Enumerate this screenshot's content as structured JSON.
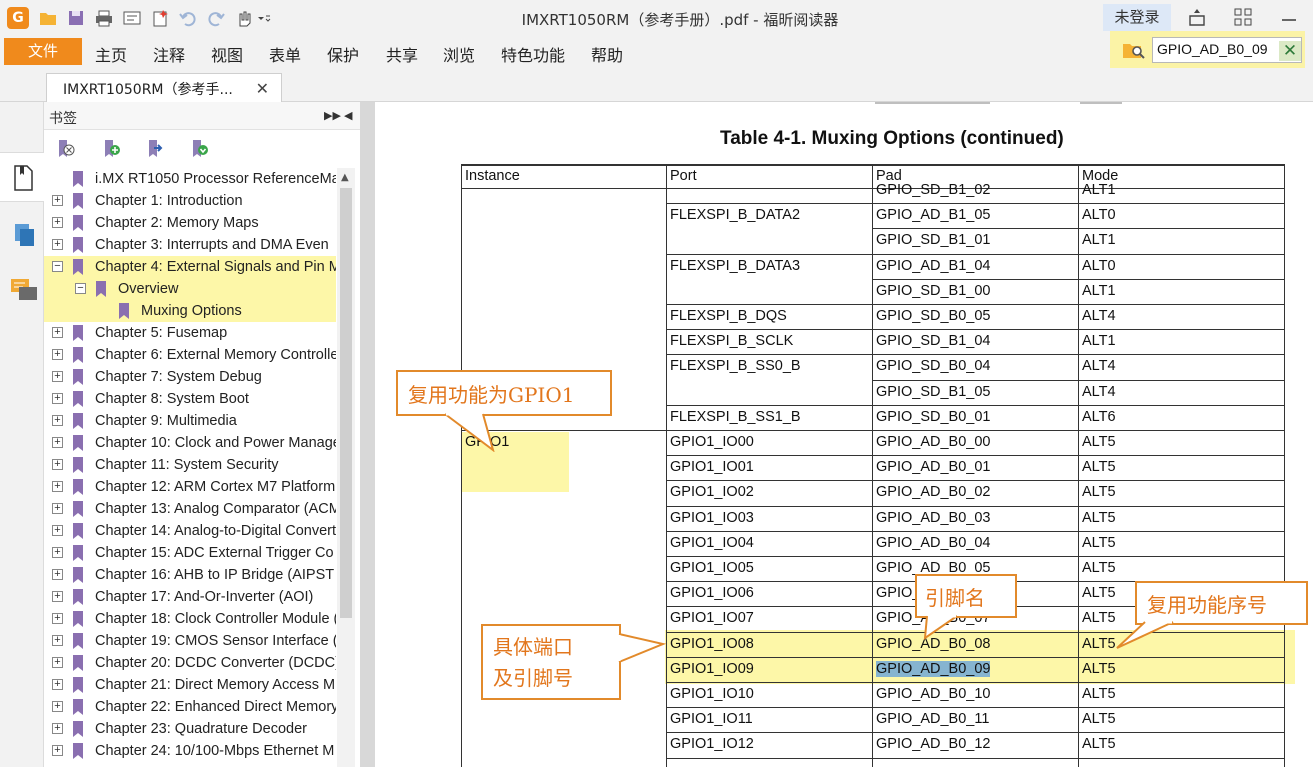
{
  "window": {
    "title": "IMXRT1050RM（参考手册）.pdf - 福昕阅读器",
    "app_icon": "G",
    "login_label": "未登录",
    "accent": "#f08a1c"
  },
  "menu": {
    "file_label": "文件",
    "items": [
      "主页",
      "注释",
      "视图",
      "表单",
      "保护",
      "共享",
      "浏览",
      "特色功能",
      "帮助"
    ]
  },
  "search": {
    "value": "GPIO_AD_B0_09"
  },
  "tab": {
    "label": "IMXRT1050RM（参考手..."
  },
  "bookmarks": {
    "panel_title": "书签",
    "items": [
      {
        "label": "i.MX RT1050 Processor ReferenceMa",
        "level": 0,
        "expander": ""
      },
      {
        "label": "Chapter 1: Introduction",
        "level": 0,
        "expander": "+"
      },
      {
        "label": "Chapter 2: Memory Maps",
        "level": 0,
        "expander": "+"
      },
      {
        "label": "Chapter 3: Interrupts and DMA Even",
        "level": 0,
        "expander": "+"
      },
      {
        "label": "Chapter 4: External Signals and Pin M",
        "level": 0,
        "expander": "-"
      },
      {
        "label": "Overview",
        "level": 1,
        "expander": "-"
      },
      {
        "label": "Muxing Options",
        "level": 2,
        "expander": ""
      },
      {
        "label": "Chapter 5:  Fusemap",
        "level": 0,
        "expander": "+"
      },
      {
        "label": "Chapter 6: External Memory Controlle",
        "level": 0,
        "expander": "+"
      },
      {
        "label": "Chapter 7: System Debug",
        "level": 0,
        "expander": "+"
      },
      {
        "label": "Chapter 8: System Boot",
        "level": 0,
        "expander": "+"
      },
      {
        "label": "Chapter 9: Multimedia",
        "level": 0,
        "expander": "+"
      },
      {
        "label": "Chapter 10: Clock and Power Manage",
        "level": 0,
        "expander": "+"
      },
      {
        "label": "Chapter 11: System Security",
        "level": 0,
        "expander": "+"
      },
      {
        "label": "Chapter 12: ARM Cortex M7 Platform",
        "level": 0,
        "expander": "+"
      },
      {
        "label": "Chapter 13: Analog Comparator (ACM",
        "level": 0,
        "expander": "+"
      },
      {
        "label": "Chapter 14: Analog-to-Digital Convert",
        "level": 0,
        "expander": "+"
      },
      {
        "label": "Chapter 15: ADC External Trigger Co",
        "level": 0,
        "expander": "+"
      },
      {
        "label": "Chapter 16: AHB to IP Bridge (AIPST",
        "level": 0,
        "expander": "+"
      },
      {
        "label": "Chapter 17: And-Or-Inverter (AOI)",
        "level": 0,
        "expander": "+"
      },
      {
        "label": "Chapter 18: Clock Controller Module (",
        "level": 0,
        "expander": "+"
      },
      {
        "label": "Chapter 19: CMOS Sensor Interface (",
        "level": 0,
        "expander": "+"
      },
      {
        "label": "Chapter 20: DCDC Converter (DCDC)",
        "level": 0,
        "expander": "+"
      },
      {
        "label": "Chapter 21: Direct Memory Access M",
        "level": 0,
        "expander": "+"
      },
      {
        "label": "Chapter 22: Enhanced Direct Memory",
        "level": 0,
        "expander": "+"
      },
      {
        "label": "Chapter 23: Quadrature Decoder",
        "level": 0,
        "expander": "+"
      },
      {
        "label": "Chapter 24: 10/100-Mbps Ethernet M",
        "level": 0,
        "expander": "+"
      }
    ]
  },
  "document": {
    "table_title": "Table 4-1.  Muxing Options (continued)",
    "columns": [
      "Instance",
      "Port",
      "Pad",
      "Mode"
    ],
    "rows": [
      {
        "instance": "",
        "port": "",
        "pad": "GPIO_SD_B1_02",
        "mode": "ALT1"
      },
      {
        "instance": "",
        "port": "FLEXSPI_B_DATA2",
        "pad": "GPIO_AD_B1_05",
        "mode": "ALT0"
      },
      {
        "instance": "",
        "port": "",
        "pad": "GPIO_SD_B1_01",
        "mode": "ALT1"
      },
      {
        "instance": "",
        "port": "FLEXSPI_B_DATA3",
        "pad": "GPIO_AD_B1_04",
        "mode": "ALT0"
      },
      {
        "instance": "",
        "port": "",
        "pad": "GPIO_SD_B1_00",
        "mode": "ALT1"
      },
      {
        "instance": "",
        "port": "FLEXSPI_B_DQS",
        "pad": "GPIO_SD_B0_05",
        "mode": "ALT4"
      },
      {
        "instance": "",
        "port": "FLEXSPI_B_SCLK",
        "pad": "GPIO_SD_B1_04",
        "mode": "ALT1"
      },
      {
        "instance": "",
        "port": "FLEXSPI_B_SS0_B",
        "pad": "GPIO_SD_B0_04",
        "mode": "ALT4"
      },
      {
        "instance": "",
        "port": "",
        "pad": "GPIO_SD_B1_05",
        "mode": "ALT4"
      },
      {
        "instance": "",
        "port": "FLEXSPI_B_SS1_B",
        "pad": "GPIO_SD_B0_01",
        "mode": "ALT6"
      },
      {
        "instance": "GPIO1",
        "port": "GPIO1_IO00",
        "pad": "GPIO_AD_B0_00",
        "mode": "ALT5"
      },
      {
        "instance": "",
        "port": "GPIO1_IO01",
        "pad": "GPIO_AD_B0_01",
        "mode": "ALT5"
      },
      {
        "instance": "",
        "port": "GPIO1_IO02",
        "pad": "GPIO_AD_B0_02",
        "mode": "ALT5"
      },
      {
        "instance": "",
        "port": "GPIO1_IO03",
        "pad": "GPIO_AD_B0_03",
        "mode": "ALT5"
      },
      {
        "instance": "",
        "port": "GPIO1_IO04",
        "pad": "GPIO_AD_B0_04",
        "mode": "ALT5"
      },
      {
        "instance": "",
        "port": "GPIO1_IO05",
        "pad": "GPIO_AD_B0_05",
        "mode": "ALT5"
      },
      {
        "instance": "",
        "port": "GPIO1_IO06",
        "pad": "GPIO_AD_B0_06",
        "mode": "ALT5"
      },
      {
        "instance": "",
        "port": "GPIO1_IO07",
        "pad": "GPIO_AD_B0_07",
        "mode": "ALT5"
      },
      {
        "instance": "",
        "port": "GPIO1_IO08",
        "pad": "GPIO_AD_B0_08",
        "mode": "ALT5"
      },
      {
        "instance": "",
        "port": "GPIO1_IO09",
        "pad": "GPIO_AD_B0_09",
        "mode": "ALT5"
      },
      {
        "instance": "",
        "port": "GPIO1_IO10",
        "pad": "GPIO_AD_B0_10",
        "mode": "ALT5"
      },
      {
        "instance": "",
        "port": "GPIO1_IO11",
        "pad": "GPIO_AD_B0_11",
        "mode": "ALT5"
      },
      {
        "instance": "",
        "port": "GPIO1_IO12",
        "pad": "GPIO_AD_B0_12",
        "mode": "ALT5"
      }
    ],
    "highlighted_ports": [
      "GPIO1_IO08",
      "GPIO1_IO09"
    ],
    "search_hit": "GPIO_AD_B0_09"
  },
  "annotations": {
    "mux_function": "复用功能为GPIO1",
    "pin_name": "引脚名",
    "mux_index": "复用功能序号",
    "port_line1": "具体端口",
    "port_line2": "及引脚号",
    "highlight_color": "#fdf7a8",
    "callout_color": "#e28a2b"
  }
}
